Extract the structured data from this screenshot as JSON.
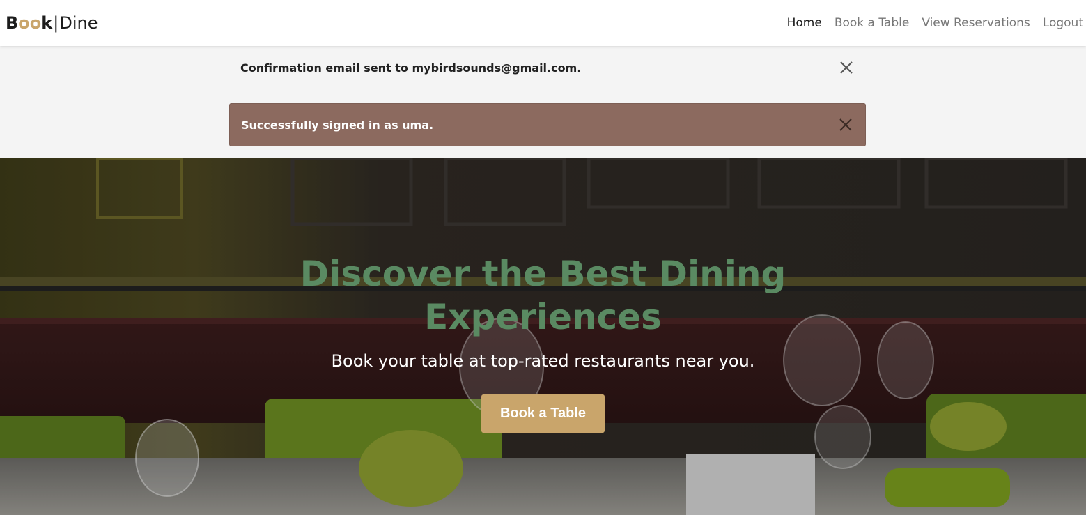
{
  "navbar": {
    "brand": {
      "first": "B",
      "middle": "oo",
      "last": "k",
      "separator": "|",
      "second": "Dine"
    },
    "links": [
      {
        "label": "Home",
        "active": true
      },
      {
        "label": "Book a Table",
        "active": false
      },
      {
        "label": "View Reservations",
        "active": false
      },
      {
        "label": "Logout",
        "active": false
      }
    ]
  },
  "messages": [
    {
      "text": "Confirmation email sent to mybirdsounds@gmail.com.",
      "style": "plain"
    },
    {
      "text": "Successfully signed in as uma.",
      "style": "brown"
    }
  ],
  "hero": {
    "title": "Discover the Best Dining Experiences",
    "subtitle": "Book your table at top-rated restaurants near you.",
    "button_label": "Book a Table"
  },
  "colors": {
    "brand_gold": "#c9a56b",
    "hero_title_green": "#5a8a62",
    "alert_brown": "#8c6a5f",
    "messages_bg": "#f4f4f4"
  }
}
